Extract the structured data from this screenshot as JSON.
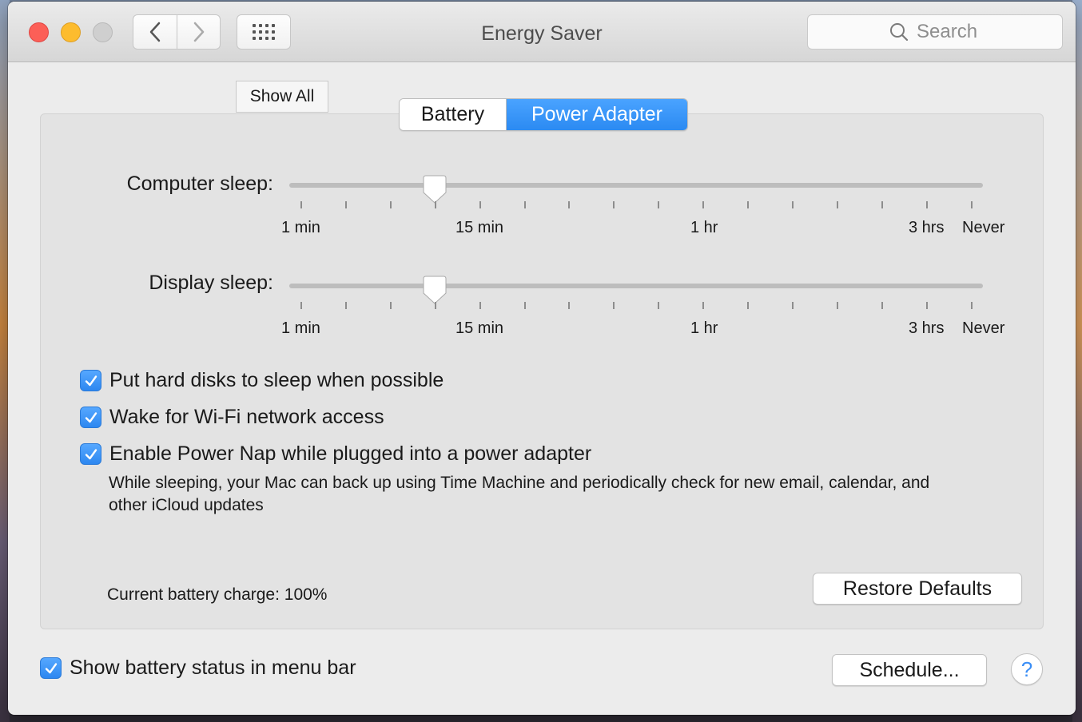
{
  "window": {
    "title": "Energy Saver"
  },
  "toolbar": {
    "search_placeholder": "Search",
    "show_all": "Show All"
  },
  "tabs": [
    {
      "label": "Battery",
      "selected": false
    },
    {
      "label": "Power Adapter",
      "selected": true
    }
  ],
  "sliders": {
    "computer_sleep": {
      "label": "Computer sleep:",
      "value_label": "10 min",
      "position_fraction": 0.21
    },
    "display_sleep": {
      "label": "Display sleep:",
      "value_label": "10 min",
      "position_fraction": 0.21
    },
    "tick_labels": [
      "1 min",
      "15 min",
      "1 hr",
      "3 hrs",
      "Never"
    ]
  },
  "options": [
    {
      "label": "Put hard disks to sleep when possible",
      "checked": true
    },
    {
      "label": "Wake for Wi-Fi network access",
      "checked": true
    },
    {
      "label": "Enable Power Nap while plugged into a power adapter",
      "checked": true
    }
  ],
  "power_nap_description": "While sleeping, your Mac can back up using Time Machine and periodically check for new email, calendar, and other iCloud updates",
  "battery_charge": "Current battery charge: 100%",
  "buttons": {
    "restore_defaults": "Restore Defaults",
    "schedule": "Schedule...",
    "help": "?"
  },
  "menu_bar_option": {
    "label": "Show battery status in menu bar",
    "checked": true
  },
  "colors": {
    "accent": "#2b8af2",
    "close": "#fc5f57",
    "minimize": "#fdbc2e",
    "zoom_disabled": "#cfcfcf"
  }
}
